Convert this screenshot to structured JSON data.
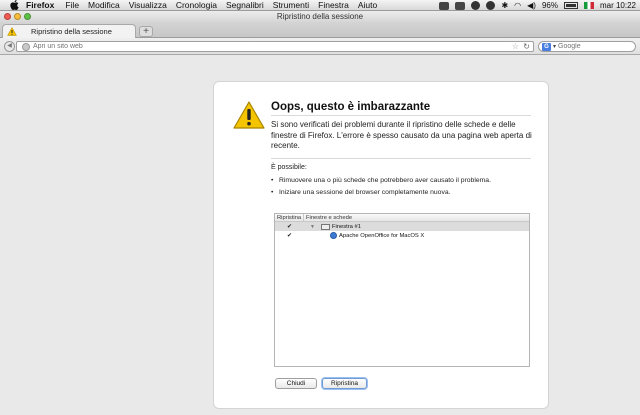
{
  "menubar": {
    "app_name": "Firefox",
    "items": [
      "File",
      "Modifica",
      "Visualizza",
      "Cronologia",
      "Segnalibri",
      "Strumenti",
      "Finestra",
      "Aiuto"
    ],
    "battery": "96%",
    "clock": "mar 10:22"
  },
  "window": {
    "title": "Ripristino della sessione"
  },
  "tabs": [
    {
      "label": "Ripristino della sessione",
      "icon": "warning-icon"
    }
  ],
  "navbar": {
    "url_placeholder": "Apri un sito web",
    "search_placeholder": "Google",
    "search_engine_letter": "G"
  },
  "page": {
    "heading": "Oops, questo è imbarazzante",
    "description": "Si sono verificati dei problemi durante il ripristino delle schede e delle finestre di Firefox. L'errore è spesso causato da una pagina web aperta di recente.",
    "possible_label": "È possibile:",
    "options": [
      "Rimuovere una o più schede che potrebbero aver causato il problema.",
      "Iniziare una sessione del browser completamente nuova."
    ],
    "tree": {
      "columns": [
        "Ripristina",
        "Finestre e schede"
      ],
      "rows": [
        {
          "checked": true,
          "label": "Finestra #1",
          "type": "window"
        },
        {
          "checked": true,
          "label": "Apache OpenOffice for MacOS X",
          "type": "tab"
        }
      ]
    },
    "buttons": {
      "close": "Chiudi",
      "restore": "Ripristina"
    }
  },
  "colors": {
    "warning_yellow": "#f5c400",
    "accent_blue": "#6f9ad6"
  }
}
